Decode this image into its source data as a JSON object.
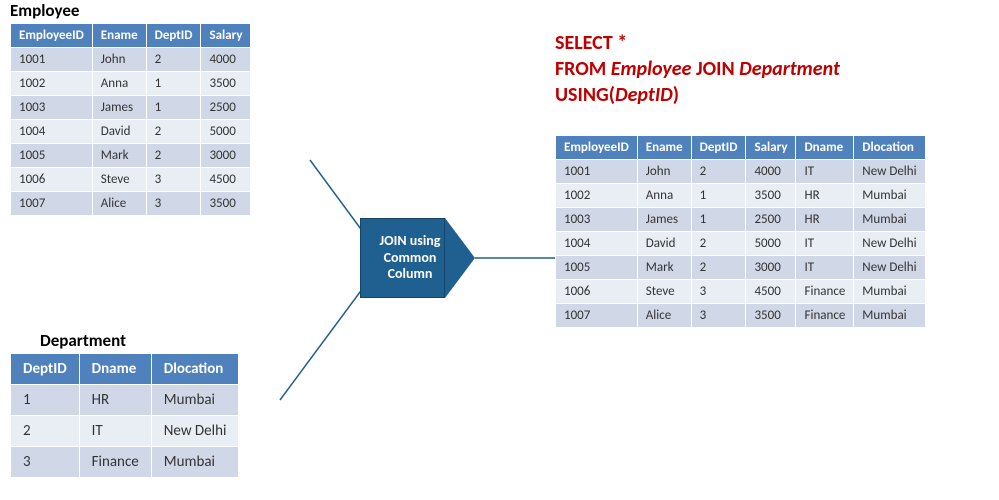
{
  "employee": {
    "title": "Employee",
    "headers": [
      "EmployeeID",
      "Ename",
      "DeptID",
      "Salary"
    ],
    "rows": [
      [
        "1001",
        "John",
        "2",
        "4000"
      ],
      [
        "1002",
        "Anna",
        "1",
        "3500"
      ],
      [
        "1003",
        "James",
        "1",
        "2500"
      ],
      [
        "1004",
        "David",
        "2",
        "5000"
      ],
      [
        "1005",
        "Mark",
        "2",
        "3000"
      ],
      [
        "1006",
        "Steve",
        "3",
        "4500"
      ],
      [
        "1007",
        "Alice",
        "3",
        "3500"
      ]
    ]
  },
  "department": {
    "title": "Department",
    "headers": [
      "DeptID",
      "Dname",
      "Dlocation"
    ],
    "rows": [
      [
        "1",
        "HR",
        "Mumbai"
      ],
      [
        "2",
        "IT",
        "New Delhi"
      ],
      [
        "3",
        "Finance",
        "Mumbai"
      ]
    ]
  },
  "join_shape": {
    "text": "JOIN using Common Column"
  },
  "sql": {
    "select": "SELECT",
    "star": "*",
    "from": "FROM",
    "t1": "Employee",
    "join": "JOIN",
    "t2": "Department",
    "using": "USING(",
    "col": "DeptID",
    "close": ")"
  },
  "result": {
    "headers": [
      "EmployeeID",
      "Ename",
      "DeptID",
      "Salary",
      "Dname",
      "Dlocation"
    ],
    "rows": [
      [
        "1001",
        "John",
        "2",
        "4000",
        "IT",
        "New Delhi"
      ],
      [
        "1002",
        "Anna",
        "1",
        "3500",
        "HR",
        "Mumbai"
      ],
      [
        "1003",
        "James",
        "1",
        "2500",
        "HR",
        "Mumbai"
      ],
      [
        "1004",
        "David",
        "2",
        "5000",
        "IT",
        "New Delhi"
      ],
      [
        "1005",
        "Mark",
        "2",
        "3000",
        "IT",
        "New Delhi"
      ],
      [
        "1006",
        "Steve",
        "3",
        "4500",
        "Finance",
        "Mumbai"
      ],
      [
        "1007",
        "Alice",
        "3",
        "3500",
        "Finance",
        "Mumbai"
      ]
    ]
  }
}
